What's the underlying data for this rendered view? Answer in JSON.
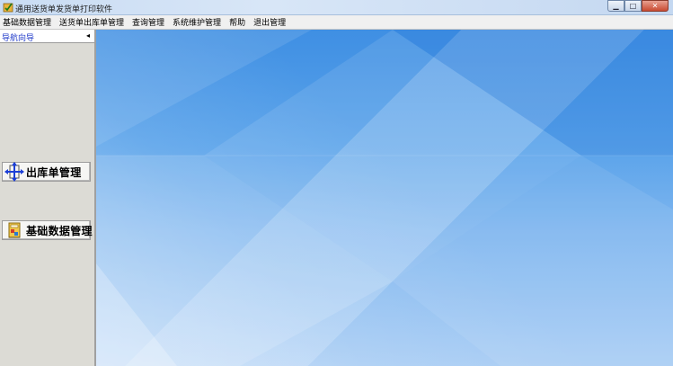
{
  "window": {
    "title": "通用送货单发货单打印软件",
    "controls": [
      "minimize",
      "maximize",
      "close"
    ]
  },
  "menu": {
    "items": [
      "基础数据管理",
      "送货单出库单管理",
      "查询管理",
      "系统维护管理",
      "帮助",
      "退出管理"
    ]
  },
  "sidebar": {
    "header": "导航向导",
    "collapse_glyph": "◂",
    "buttons": [
      {
        "label": "出库单管理",
        "icon": "outbound-arrows-icon"
      },
      {
        "label": "基础数据管理",
        "icon": "database-folder-icon"
      }
    ]
  },
  "colors": {
    "titlebar": "#c9dcf3",
    "sidebar_bg": "#dcdbd5",
    "nav_header_text": "#1f39c9",
    "main_top": "#3f8fe3",
    "main_bottom": "#a9cdf4"
  }
}
